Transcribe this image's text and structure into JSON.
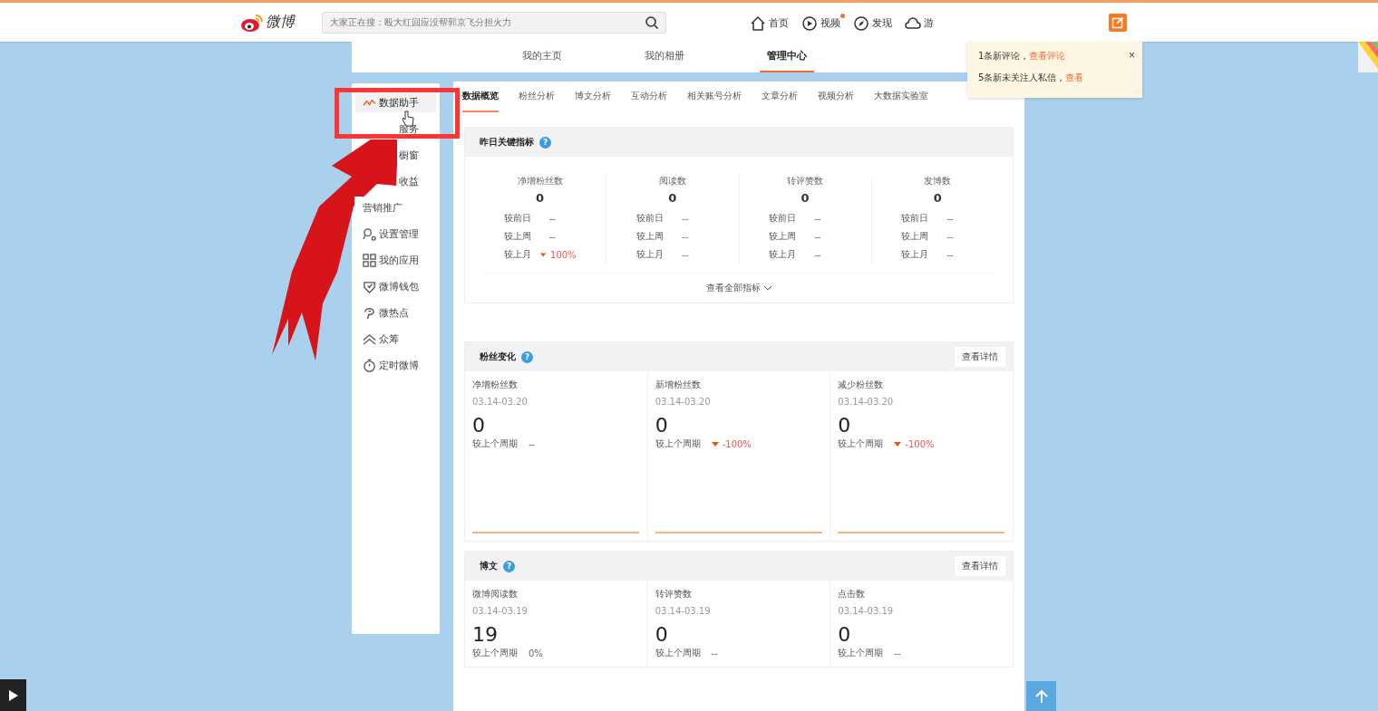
{
  "header": {
    "logo": "微博",
    "search": {
      "placeholder": "大家正在搜：殴大红回应没帮郭京飞分担火力"
    },
    "nav": [
      {
        "label": "首页",
        "dot": false
      },
      {
        "label": "视频",
        "dot": true
      },
      {
        "label": "发现",
        "dot": false
      },
      {
        "label": "游",
        "dot": false
      }
    ]
  },
  "profile_tabs": [
    {
      "label": "我的主页",
      "selected": false
    },
    {
      "label": "我的相册",
      "selected": false
    },
    {
      "label": "管理中心",
      "selected": true
    }
  ],
  "notification": {
    "lines": [
      {
        "text": "1条新评论，",
        "link": "查看评论"
      },
      {
        "text": "5条新未关注人私信，",
        "link": "查看"
      }
    ],
    "close": "×"
  },
  "sidebar": {
    "items": [
      {
        "label": "数据助手",
        "selected": true,
        "partly_hidden": false
      },
      {
        "label": "服务",
        "selected": false,
        "partly_hidden": true
      },
      {
        "label": "橱窗",
        "selected": false,
        "partly_hidden": true
      },
      {
        "label": "收益",
        "selected": false,
        "partly_hidden": true
      },
      {
        "label": "营销推广",
        "selected": false,
        "partly_hidden": false
      },
      {
        "label": "设置管理",
        "selected": false,
        "partly_hidden": false
      },
      {
        "label": "我的应用",
        "selected": false,
        "partly_hidden": false
      },
      {
        "label": "微博钱包",
        "selected": false,
        "partly_hidden": false
      },
      {
        "label": "微热点",
        "selected": false,
        "partly_hidden": false
      },
      {
        "label": "众筹",
        "selected": false,
        "partly_hidden": false
      },
      {
        "label": "定时微博",
        "selected": false,
        "partly_hidden": false
      }
    ]
  },
  "analysis_tabs": [
    {
      "label": "数据概览",
      "selected": true
    },
    {
      "label": "粉丝分析",
      "selected": false
    },
    {
      "label": "博文分析",
      "selected": false
    },
    {
      "label": "互动分析",
      "selected": false
    },
    {
      "label": "相关账号分析",
      "selected": false
    },
    {
      "label": "文章分析",
      "selected": false
    },
    {
      "label": "视频分析",
      "selected": false
    },
    {
      "label": "大数据实验室",
      "selected": false
    }
  ],
  "key_metrics": {
    "title": "昨日关键指标",
    "help": "?",
    "more": "查看全部指标",
    "metrics": [
      {
        "name": "净增粉丝数",
        "value": "0",
        "compare": [
          {
            "label": "较前日",
            "value": "--",
            "down": false
          },
          {
            "label": "较上周",
            "value": "--",
            "down": false
          },
          {
            "label": "较上月",
            "value": "100%",
            "down": true
          }
        ]
      },
      {
        "name": "阅读数",
        "value": "0",
        "compare": [
          {
            "label": "较前日",
            "value": "--",
            "down": false
          },
          {
            "label": "较上周",
            "value": "--",
            "down": false
          },
          {
            "label": "较上月",
            "value": "--",
            "down": false
          }
        ]
      },
      {
        "name": "转评赞数",
        "value": "0",
        "compare": [
          {
            "label": "较前日",
            "value": "--",
            "down": false
          },
          {
            "label": "较上周",
            "value": "--",
            "down": false
          },
          {
            "label": "较上月",
            "value": "--",
            "down": false
          }
        ]
      },
      {
        "name": "发博数",
        "value": "0",
        "compare": [
          {
            "label": "较前日",
            "value": "--",
            "down": false
          },
          {
            "label": "较上周",
            "value": "--",
            "down": false
          },
          {
            "label": "较上月",
            "value": "--",
            "down": false
          }
        ]
      }
    ]
  },
  "sections": [
    {
      "title": "粉丝变化",
      "help": "?",
      "button": "查看详情",
      "trend_lines": true,
      "cards": [
        {
          "name": "净增粉丝数",
          "range": "03.14-03.20",
          "value": "0",
          "compare_label": "较上个周期",
          "compare_value": "--",
          "down": false
        },
        {
          "name": "新增粉丝数",
          "range": "03.14-03.20",
          "value": "0",
          "compare_label": "较上个周期",
          "compare_value": "-100%",
          "down": true
        },
        {
          "name": "减少粉丝数",
          "range": "03.14-03.20",
          "value": "0",
          "compare_label": "较上个周期",
          "compare_value": "-100%",
          "down": true
        }
      ]
    },
    {
      "title": "博文",
      "help": "?",
      "button": "查看详情",
      "trend_lines": false,
      "cards": [
        {
          "name": "微博阅读数",
          "range": "03.14-03.19",
          "value": "19",
          "compare_label": "较上个周期",
          "compare_value": "0%",
          "down": false
        },
        {
          "name": "转评赞数",
          "range": "03.14-03.19",
          "value": "0",
          "compare_label": "较上个周期",
          "compare_value": "--",
          "down": false
        },
        {
          "name": "点击数",
          "range": "03.14-03.19",
          "value": "0",
          "compare_label": "较上个周期",
          "compare_value": "--",
          "down": false
        }
      ]
    }
  ]
}
